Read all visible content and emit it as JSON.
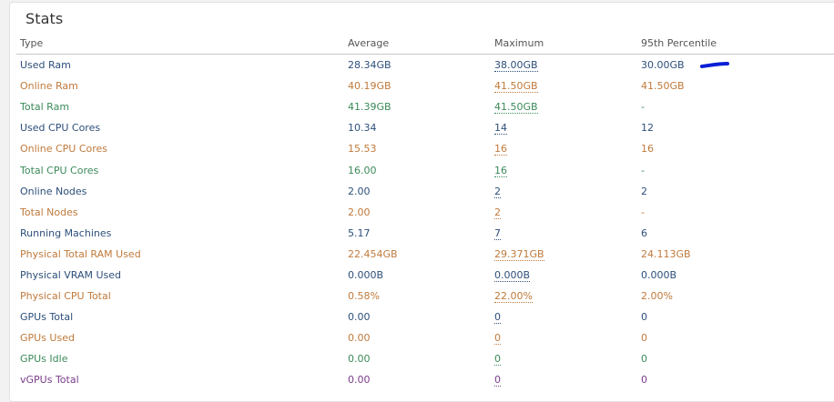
{
  "panel": {
    "title": "Stats"
  },
  "table": {
    "headers": [
      "Type",
      "Average",
      "Maximum",
      "95th Percentile"
    ],
    "rows": [
      {
        "type": "Used Ram",
        "average": "28.34GB",
        "maximum": "38.00GB",
        "p95": "30.00GB",
        "color": "#2d4f7a"
      },
      {
        "type": "Online Ram",
        "average": "40.19GB",
        "maximum": "41.50GB",
        "p95": "41.50GB",
        "color": "#c07a3c"
      },
      {
        "type": "Total Ram",
        "average": "41.39GB",
        "maximum": "41.50GB",
        "p95": "-",
        "color": "#3c8a5a"
      },
      {
        "type": "Used CPU Cores",
        "average": "10.34",
        "maximum": "14",
        "p95": "12",
        "color": "#2d4f7a"
      },
      {
        "type": "Online CPU Cores",
        "average": "15.53",
        "maximum": "16",
        "p95": "16",
        "color": "#c07a3c"
      },
      {
        "type": "Total CPU Cores",
        "average": "16.00",
        "maximum": "16",
        "p95": "-",
        "color": "#3c8a5a"
      },
      {
        "type": "Online Nodes",
        "average": "2.00",
        "maximum": "2",
        "p95": "2",
        "color": "#2d4f7a"
      },
      {
        "type": "Total Nodes",
        "average": "2.00",
        "maximum": "2",
        "p95": "-",
        "color": "#c07a3c"
      },
      {
        "type": "Running Machines",
        "average": "5.17",
        "maximum": "7",
        "p95": "6",
        "color": "#2d4f7a"
      },
      {
        "type": "Physical Total RAM Used",
        "average": "22.454GB",
        "maximum": "29.371GB",
        "p95": "24.113GB",
        "color": "#c07a3c"
      },
      {
        "type": "Physical VRAM Used",
        "average": "0.000B",
        "maximum": "0.000B",
        "p95": "0.000B",
        "color": "#2d4f7a"
      },
      {
        "type": "Physical CPU Total",
        "average": "0.58%",
        "maximum": "22.00%",
        "p95": "2.00%",
        "color": "#c07a3c"
      },
      {
        "type": "GPUs Total",
        "average": "0.00",
        "maximum": "0",
        "p95": "0",
        "color": "#2d4f7a"
      },
      {
        "type": "GPUs Used",
        "average": "0.00",
        "maximum": "0",
        "p95": "0",
        "color": "#c07a3c"
      },
      {
        "type": "GPUs Idle",
        "average": "0.00",
        "maximum": "0",
        "p95": "0",
        "color": "#3c8a5a"
      },
      {
        "type": "vGPUs Total",
        "average": "0.00",
        "maximum": "0",
        "p95": "0",
        "color": "#7a3c8a"
      }
    ]
  },
  "annotation": {
    "color": "#0a1fd6"
  }
}
